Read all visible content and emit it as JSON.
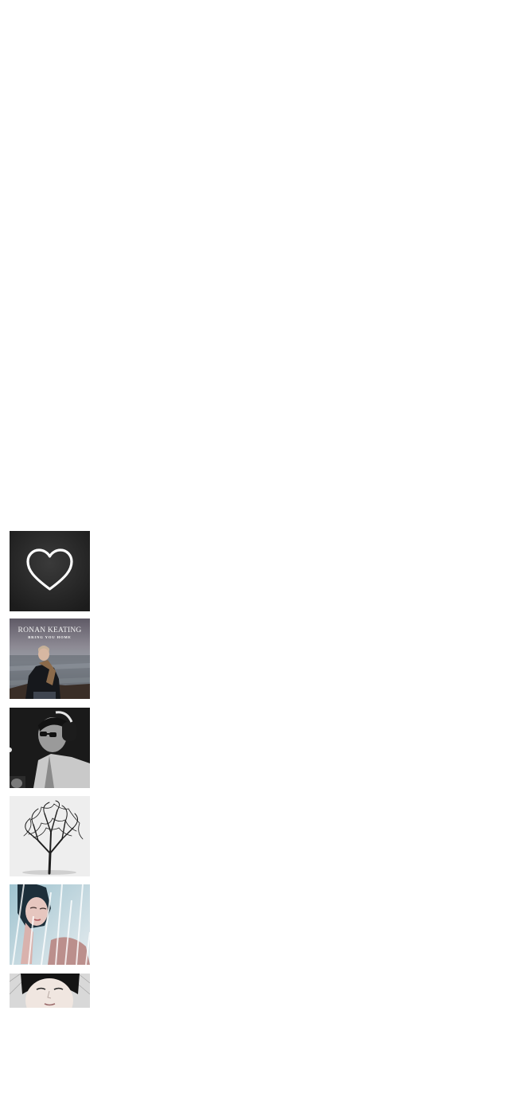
{
  "playlist": {
    "thumbnails": [
      {
        "id": "liked",
        "icon": "heart-icon"
      },
      {
        "id": "cover-2",
        "text_line_1": "RONAN KEATING",
        "text_line_2": "BRING YOU HOME"
      },
      {
        "id": "cover-3"
      },
      {
        "id": "cover-4"
      },
      {
        "id": "cover-5"
      },
      {
        "id": "cover-6"
      }
    ]
  },
  "colors": {
    "background": "#ffffff",
    "liked_tile": "#262626",
    "heart_stroke": "#ffffff"
  }
}
